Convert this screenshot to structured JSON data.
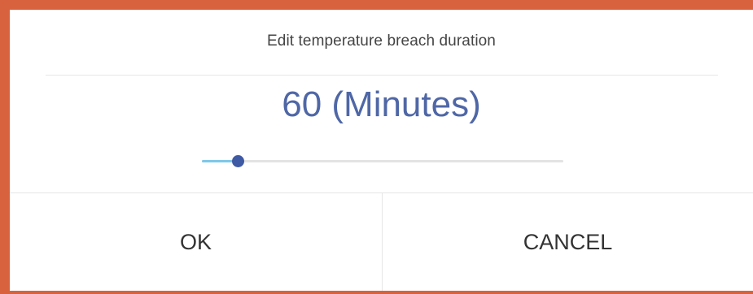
{
  "dialog": {
    "title": "Edit temperature breach duration",
    "value_text": "60 (Minutes)",
    "slider": {
      "value": 60,
      "fraction": 0.1
    }
  },
  "actions": {
    "ok_label": "OK",
    "cancel_label": "CANCEL"
  },
  "colors": {
    "border": "#d9623e",
    "value_text": "#4f67a6",
    "slider_fill": "#7ec8e9",
    "slider_thumb": "#3f5aa4"
  }
}
